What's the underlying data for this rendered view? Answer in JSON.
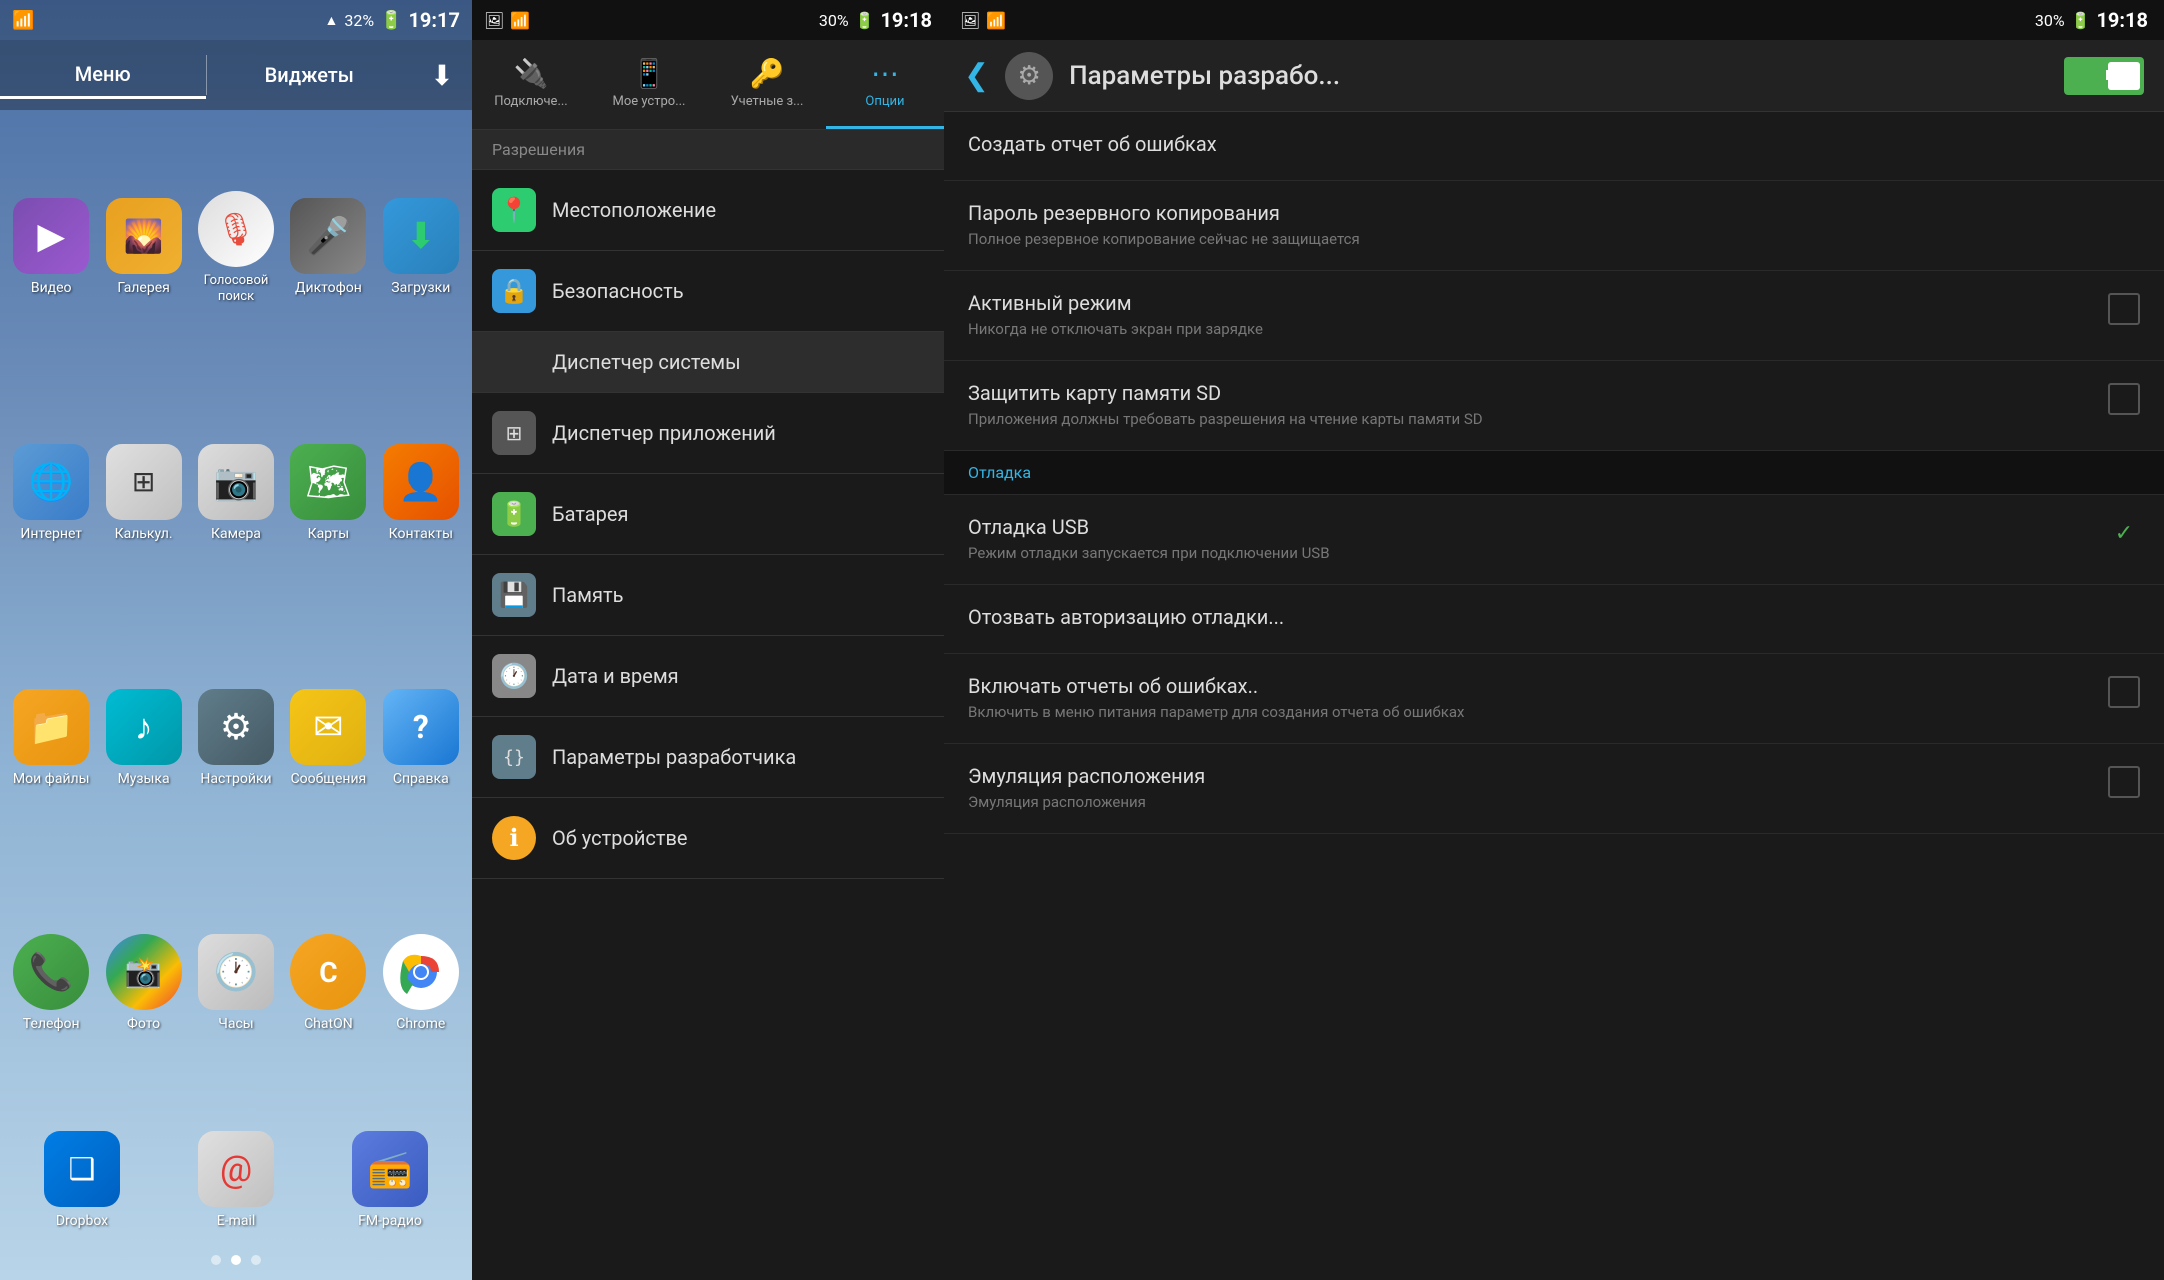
{
  "panel1": {
    "status_bar": {
      "wifi": "📶",
      "signal": "▲▲",
      "battery_pct": "32%",
      "time": "19:17"
    },
    "tabs": [
      {
        "label": "Меню",
        "active": true
      },
      {
        "label": "Виджеты",
        "active": false
      }
    ],
    "download_icon": "⬇",
    "apps": [
      {
        "id": "video",
        "label": "Видео",
        "icon": "▶",
        "class": "icon-video"
      },
      {
        "id": "gallery",
        "label": "Галерея",
        "icon": "🌄",
        "class": "icon-gallery"
      },
      {
        "id": "voice",
        "label": "Голосовой поиск",
        "icon": "🎙",
        "class": "icon-voice"
      },
      {
        "id": "dictaphone",
        "label": "Диктофон",
        "icon": "🎤",
        "class": "icon-dictaphone"
      },
      {
        "id": "downloads",
        "label": "Загрузки",
        "icon": "⬇",
        "class": "icon-downloads"
      },
      {
        "id": "internet",
        "label": "Интернет",
        "icon": "🌐",
        "class": "icon-internet"
      },
      {
        "id": "calc",
        "label": "Калькул.",
        "icon": "⊞",
        "class": "icon-calc"
      },
      {
        "id": "camera",
        "label": "Камера",
        "icon": "📷",
        "class": "icon-camera"
      },
      {
        "id": "maps",
        "label": "Карты",
        "icon": "🗺",
        "class": "icon-maps"
      },
      {
        "id": "contacts",
        "label": "Контакты",
        "icon": "👤",
        "class": "icon-contacts"
      },
      {
        "id": "myfiles",
        "label": "Мои файлы",
        "icon": "📁",
        "class": "icon-myfiles"
      },
      {
        "id": "music",
        "label": "Музыка",
        "icon": "♪",
        "class": "icon-music"
      },
      {
        "id": "settings",
        "label": "Настройки",
        "icon": "⚙",
        "class": "icon-settings"
      },
      {
        "id": "messages",
        "label": "Сообщения",
        "icon": "✉",
        "class": "icon-messages"
      },
      {
        "id": "help",
        "label": "Справка",
        "icon": "?",
        "class": "icon-help"
      },
      {
        "id": "phone",
        "label": "Телефон",
        "icon": "📞",
        "class": "icon-phone"
      },
      {
        "id": "photos",
        "label": "Фото",
        "icon": "📸",
        "class": "icon-photos"
      },
      {
        "id": "clock",
        "label": "Часы",
        "icon": "🕐",
        "class": "icon-clock"
      },
      {
        "id": "chaton",
        "label": "ChatON",
        "icon": "C",
        "class": "icon-chaton"
      },
      {
        "id": "chrome",
        "label": "Chrome",
        "icon": "◎",
        "class": "icon-chrome"
      },
      {
        "id": "dropbox",
        "label": "Dropbox",
        "icon": "❑",
        "class": "icon-dropbox"
      },
      {
        "id": "email",
        "label": "E-mail",
        "icon": "@",
        "class": "icon-email"
      },
      {
        "id": "fmradio",
        "label": "FM-радио",
        "icon": "📻",
        "class": "icon-fmradio"
      }
    ],
    "dots": [
      false,
      true,
      false
    ]
  },
  "panel2": {
    "status_bar": {
      "battery_pct": "30%",
      "time": "19:18"
    },
    "tabs": [
      {
        "label": "Подключе...",
        "icon": "🔌",
        "active": false
      },
      {
        "label": "Мое устро...",
        "icon": "📱",
        "active": false
      },
      {
        "label": "Учетные з...",
        "icon": "🔑",
        "active": false
      },
      {
        "label": "Опции",
        "icon": "⋯",
        "active": true
      }
    ],
    "section_header": "Разрешения",
    "items": [
      {
        "id": "location",
        "label": "Местоположение",
        "icon": "📍",
        "icon_class": "si-location",
        "selected": false
      },
      {
        "id": "security",
        "label": "Безопасность",
        "icon": "🔒",
        "icon_class": "si-security",
        "selected": false
      },
      {
        "id": "system_manager",
        "label": "Диспетчер системы",
        "icon": "",
        "icon_class": "",
        "selected": true,
        "no_icon": true
      },
      {
        "id": "app_manager",
        "label": "Диспетчер приложений",
        "icon": "⊞",
        "icon_class": "si-appmanager",
        "selected": false
      },
      {
        "id": "battery",
        "label": "Батарея",
        "icon": "🔋",
        "icon_class": "si-battery",
        "selected": false
      },
      {
        "id": "memory",
        "label": "Память",
        "icon": "💾",
        "icon_class": "si-memory",
        "selected": false
      },
      {
        "id": "datetime",
        "label": "Дата и время",
        "icon": "🕐",
        "icon_class": "si-datetime",
        "selected": false
      },
      {
        "id": "devtools",
        "label": "Параметры разработчика",
        "icon": "{}",
        "icon_class": "si-devtools",
        "selected": false
      },
      {
        "id": "about",
        "label": "Об устройстве",
        "icon": "ℹ",
        "icon_class": "si-about",
        "selected": false
      }
    ]
  },
  "panel3": {
    "status_bar": {
      "battery_pct": "30%",
      "time": "19:18"
    },
    "header": {
      "back_icon": "❮",
      "settings_icon": "⚙",
      "title": "Параметры разрабо...",
      "toggle_state": "on"
    },
    "items": [
      {
        "id": "bug-report",
        "title": "Создать отчет об ошибках",
        "subtitle": "",
        "type": "item",
        "checked": null
      },
      {
        "id": "backup-pass",
        "title": "Пароль резервного копирования",
        "subtitle": "Полное резервное копирование сейчас не защищается",
        "type": "item",
        "checked": null
      },
      {
        "id": "active-mode",
        "title": "Активный режим",
        "subtitle": "Никогда не отключать экран при зарядке",
        "type": "checkbox",
        "checked": false
      },
      {
        "id": "protect-sd",
        "title": "Защитить карту памяти SD",
        "subtitle": "Приложения должны требовать разрешения на чтение карты памяти SD",
        "type": "checkbox",
        "checked": false
      },
      {
        "id": "debug-section",
        "title": "Отладка",
        "subtitle": "",
        "type": "section"
      },
      {
        "id": "usb-debug",
        "title": "Отладка USB",
        "subtitle": "Режим отладки запускается при подключении USB",
        "type": "checkbox",
        "checked": true
      },
      {
        "id": "revoke-debug",
        "title": "Отозвать авторизацию отладки...",
        "subtitle": "",
        "type": "item",
        "checked": null
      },
      {
        "id": "error-reports",
        "title": "Включать отчеты об ошибках..",
        "subtitle": "Включить в меню питания параметр для создания отчета об ошибках",
        "type": "checkbox",
        "checked": false
      },
      {
        "id": "mock-location",
        "title": "Эмуляция расположения",
        "subtitle": "Эмуляция расположения",
        "type": "checkbox",
        "checked": false
      }
    ]
  }
}
